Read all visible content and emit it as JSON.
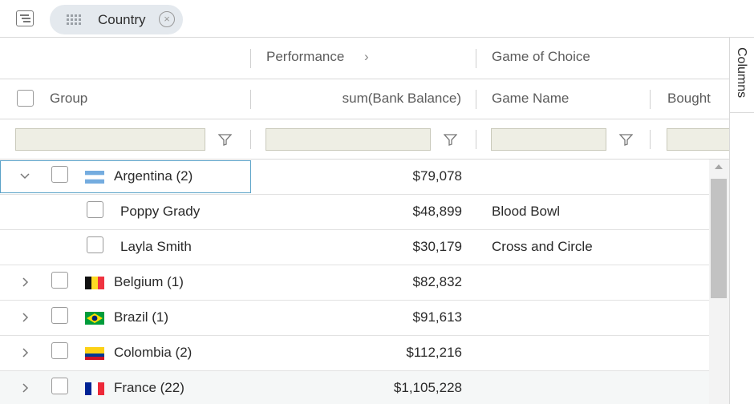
{
  "group_panel": {
    "chip_label": "Country",
    "chip_close_glyph": "×"
  },
  "header": {
    "group_row": {
      "performance_label": "Performance",
      "performance_chevron": "›",
      "game_of_choice_label": "Game of Choice"
    },
    "columns": {
      "group": "Group",
      "bank_balance": "sum(Bank Balance)",
      "game_name": "Game Name",
      "bought": "Bought"
    }
  },
  "side_bar": {
    "columns_tab": "Columns"
  },
  "rows": [
    {
      "label": "Argentina (2)",
      "balance": "$79,078",
      "game": "",
      "expanded": true,
      "flag": "argentina-flag-icon"
    },
    {
      "label": "Poppy Grady",
      "balance": "$48,899",
      "game": "Blood Bowl",
      "child": true
    },
    {
      "label": "Layla Smith",
      "balance": "$30,179",
      "game": "Cross and Circle",
      "child": true
    },
    {
      "label": "Belgium (1)",
      "balance": "$82,832",
      "game": "",
      "flag": "belgium-flag-icon"
    },
    {
      "label": "Brazil (1)",
      "balance": "$91,613",
      "game": "",
      "flag": "brazil-flag-icon"
    },
    {
      "label": "Colombia (2)",
      "balance": "$112,216",
      "game": "",
      "flag": "colombia-flag-icon"
    },
    {
      "label": "France (22)",
      "balance": "$1,105,228",
      "game": "",
      "flag": "france-flag-icon"
    }
  ],
  "icons": {
    "expanded": "chevron-down-icon",
    "collapsed": "chevron-right-icon",
    "filter": "filter-icon",
    "group_panel": "group-panel-icon",
    "drag": "drag-grip-icon"
  },
  "colors": {
    "focus_border": "#5aa2c8",
    "chip_background": "#e4e9ee",
    "filter_input_background": "#eeeee4"
  }
}
